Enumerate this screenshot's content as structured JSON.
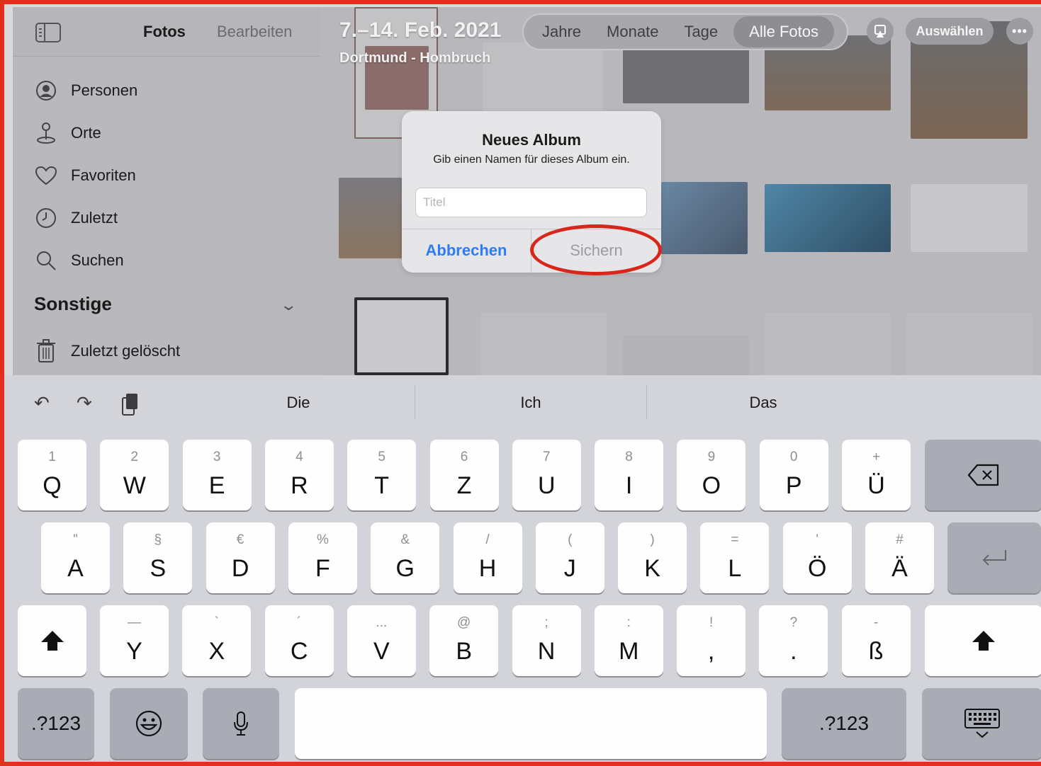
{
  "sidebar": {
    "title": "Fotos",
    "edit_label": "Bearbeiten",
    "items": [
      {
        "label": "Personen",
        "icon": "person-circle-icon"
      },
      {
        "label": "Orte",
        "icon": "map-pin-icon"
      },
      {
        "label": "Favoriten",
        "icon": "heart-icon"
      },
      {
        "label": "Zuletzt",
        "icon": "clock-icon"
      },
      {
        "label": "Suchen",
        "icon": "search-icon"
      }
    ],
    "section_title": "Sonstige",
    "deleted_label": "Zuletzt gelöscht"
  },
  "header": {
    "date_title": "7.–14. Feb. 2021",
    "location": "Dortmund - Hombruch",
    "segments": [
      "Jahre",
      "Monate",
      "Tage",
      "Alle Fotos"
    ],
    "active_segment": "Alle Fotos",
    "select_label": "Auswählen",
    "more_label": "•••"
  },
  "dialog": {
    "title": "Neues Album",
    "message": "Gib einen Namen für dieses Album ein.",
    "input_placeholder": "Titel",
    "input_value": "",
    "cancel_label": "Abbrechen",
    "save_label": "Sichern"
  },
  "keyboard": {
    "suggestions": [
      "Die",
      "Ich",
      "Das"
    ],
    "row1": [
      {
        "sec": "1",
        "pri": "Q"
      },
      {
        "sec": "2",
        "pri": "W"
      },
      {
        "sec": "3",
        "pri": "E"
      },
      {
        "sec": "4",
        "pri": "R"
      },
      {
        "sec": "5",
        "pri": "T"
      },
      {
        "sec": "6",
        "pri": "Z"
      },
      {
        "sec": "7",
        "pri": "U"
      },
      {
        "sec": "8",
        "pri": "I"
      },
      {
        "sec": "9",
        "pri": "O"
      },
      {
        "sec": "0",
        "pri": "P"
      },
      {
        "sec": "+",
        "pri": "Ü"
      }
    ],
    "row2": [
      {
        "sec": "\"",
        "pri": "A"
      },
      {
        "sec": "§",
        "pri": "S"
      },
      {
        "sec": "€",
        "pri": "D"
      },
      {
        "sec": "%",
        "pri": "F"
      },
      {
        "sec": "&",
        "pri": "G"
      },
      {
        "sec": "/",
        "pri": "H"
      },
      {
        "sec": "(",
        "pri": "J"
      },
      {
        "sec": ")",
        "pri": "K"
      },
      {
        "sec": "=",
        "pri": "L"
      },
      {
        "sec": "'",
        "pri": "Ö"
      },
      {
        "sec": "#",
        "pri": "Ä"
      }
    ],
    "row3": [
      {
        "sec": "—",
        "pri": "Y"
      },
      {
        "sec": "`",
        "pri": "X"
      },
      {
        "sec": "´",
        "pri": "C"
      },
      {
        "sec": "...",
        "pri": "V"
      },
      {
        "sec": "@",
        "pri": "B"
      },
      {
        "sec": ";",
        "pri": "N"
      },
      {
        "sec": ":",
        "pri": "M"
      },
      {
        "sec": "!",
        "pri": ","
      },
      {
        "sec": "?",
        "pri": "."
      },
      {
        "sec": "-",
        "pri": "ß"
      }
    ],
    "numbers_label": ".?123",
    "numbers_label_right": ".?123"
  }
}
